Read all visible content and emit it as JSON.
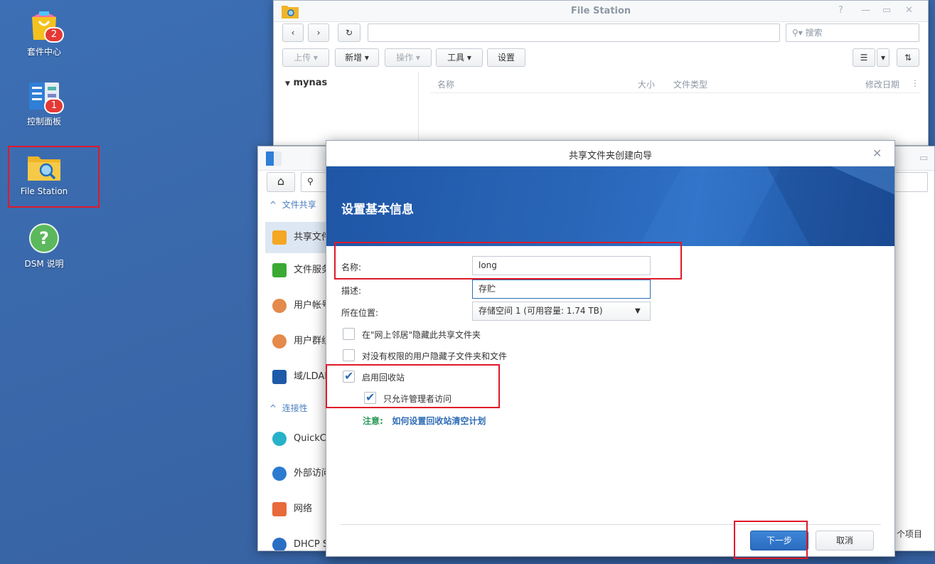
{
  "desktop": {
    "icons": [
      {
        "label": "套件中心",
        "badge": "2"
      },
      {
        "label": "控制面板",
        "badge": "1"
      },
      {
        "label": "File Station",
        "badge": ""
      },
      {
        "label": "DSM 说明",
        "badge": ""
      }
    ]
  },
  "file_station": {
    "title": "File Station",
    "search_placeholder": "搜索",
    "toolbar": {
      "upload": "上传",
      "new": "新增",
      "action": "操作",
      "tools": "工具",
      "settings": "设置"
    },
    "tree_root": "mynas",
    "columns": [
      "名称",
      "大小",
      "文件类型",
      "修改日期"
    ]
  },
  "control_panel": {
    "section_file_sharing": "文件共享",
    "section_connectivity": "连接性",
    "items": [
      {
        "label": "共享文件",
        "color": "#f5a623"
      },
      {
        "label": "文件服务",
        "color": "#3aaa35"
      },
      {
        "label": "用户帐号",
        "color": "#e48a4b"
      },
      {
        "label": "用户群组",
        "color": "#e48a4b"
      },
      {
        "label": "域/LDAP",
        "color": "#1e5aa8"
      },
      {
        "label": "QuickConnect",
        "color": "#27b2c9"
      },
      {
        "label": "外部访问",
        "color": "#2b7bd0"
      },
      {
        "label": "网络",
        "color": "#e86a3a"
      },
      {
        "label": "DHCP Server",
        "color": "#2b6fc4"
      }
    ],
    "status_text": "个项目"
  },
  "wizard": {
    "title": "共享文件夹创建向导",
    "heading": "设置基本信息",
    "name_label": "名称:",
    "name_value": "long",
    "desc_label": "描述:",
    "desc_value": "存贮",
    "location_label": "所在位置:",
    "location_value": "存储空间 1 (可用容量:  1.74 TB)",
    "options": [
      {
        "label": "在\"网上邻居\"隐藏此共享文件夹",
        "checked": false
      },
      {
        "label": "对没有权限的用户隐藏子文件夹和文件",
        "checked": false
      },
      {
        "label": "启用回收站",
        "checked": true
      },
      {
        "label": "只允许管理者访问",
        "checked": true
      }
    ],
    "note_prefix": "注意:",
    "note_link": "如何设置回收站清空计划",
    "next_button": "下一步",
    "cancel_button": "取消"
  }
}
